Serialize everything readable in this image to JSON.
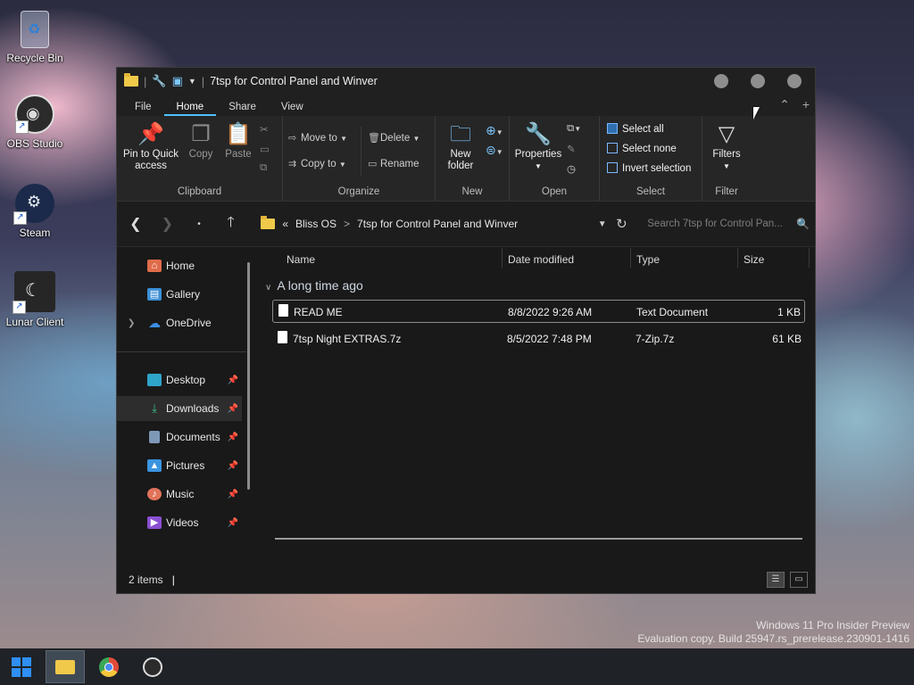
{
  "desktop": {
    "icons": [
      {
        "label": "Recycle Bin"
      },
      {
        "label": "OBS Studio"
      },
      {
        "label": "Steam"
      },
      {
        "label": "Lunar Client"
      }
    ],
    "watermark_line1": "Windows 11 Pro Insider Preview",
    "watermark_line2": "Evaluation copy. Build 25947.rs_prerelease.230901-1416"
  },
  "window": {
    "title": "7tsp for Control Panel and Winver",
    "tabs": [
      "File",
      "Home",
      "Share",
      "View"
    ],
    "active_tab": "Home"
  },
  "ribbon": {
    "clipboard": {
      "name": "Clipboard",
      "pin": "Pin to Quick access",
      "copy": "Copy",
      "paste": "Paste"
    },
    "organize": {
      "name": "Organize",
      "move_to": "Move to",
      "copy_to": "Copy to",
      "delete": "Delete",
      "rename": "Rename"
    },
    "new": {
      "name": "New",
      "new_folder": "New folder"
    },
    "open": {
      "name": "Open",
      "properties": "Properties"
    },
    "select": {
      "name": "Select",
      "select_all": "Select all",
      "select_none": "Select none",
      "invert": "Invert selection"
    },
    "filter": {
      "name": "Filter",
      "filters": "Filters"
    }
  },
  "address": {
    "overflow": "«",
    "crumb1": "Bliss OS",
    "separator": ">",
    "crumb2": "7tsp for Control Panel and Winver",
    "search_placeholder": "Search 7tsp for Control Pan..."
  },
  "navpane": {
    "items": [
      {
        "label": "Home",
        "icon": "home-icon"
      },
      {
        "label": "Gallery",
        "icon": "gallery-icon"
      },
      {
        "label": "OneDrive",
        "icon": "onedrive-icon"
      },
      {
        "label": "Desktop",
        "icon": "desktop-icon"
      },
      {
        "label": "Downloads",
        "icon": "downloads-icon"
      },
      {
        "label": "Documents",
        "icon": "documents-icon"
      },
      {
        "label": "Pictures",
        "icon": "pictures-icon"
      },
      {
        "label": "Music",
        "icon": "music-icon"
      },
      {
        "label": "Videos",
        "icon": "videos-icon"
      }
    ],
    "selected": "Downloads"
  },
  "files": {
    "columns": [
      "Name",
      "Date modified",
      "Type",
      "Size"
    ],
    "group_label": "A long time ago",
    "rows": [
      {
        "name": "READ ME",
        "date": "8/8/2022 9:26 AM",
        "type": "Text Document",
        "size": "1 KB"
      },
      {
        "name": "7tsp Night EXTRAS.7z",
        "date": "8/5/2022 7:48 PM",
        "type": "7-Zip.7z",
        "size": "61 KB"
      }
    ]
  },
  "status": {
    "count": "2 items",
    "caret": "|"
  },
  "colors": {
    "accent": "#4cc2ff",
    "window_bg": "#191919",
    "ribbon_bg": "#262626",
    "taskbar_bg": "#1f2226"
  }
}
